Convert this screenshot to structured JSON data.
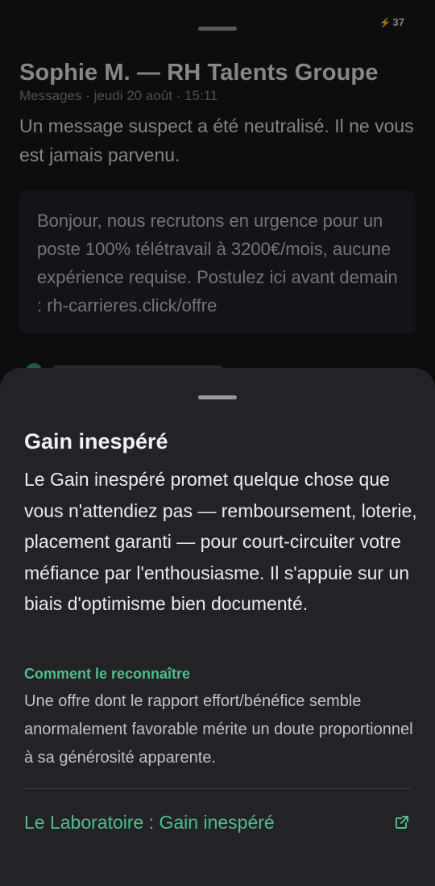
{
  "status_bar": {
    "battery_level": "37"
  },
  "message_view": {
    "sender": "Sophie M. — RH Talents Groupe",
    "meta": "Messages · jeudi 20 août · 15:11",
    "neutralized_notice": "Un message suspect a été neutralisé. Il ne vous est jamais parvenu.",
    "original_message": "Bonjour, nous recrutons en urgence pour un poste 100% télétravail à 3200€/mois, aucune expérience requise. Postulez ici avant demain : rh-carrieres.click/offre"
  },
  "sheet": {
    "title": "Gain inespéré",
    "body": "Le Gain inespéré promet quelque chose que vous n'attendiez pas — remboursement, loterie, placement garanti — pour court-circuiter votre méfiance par l'enthousiasme. Il s'appuie sur un biais d'optimisme bien documenté.",
    "section_label": "Comment le reconnaître",
    "section_text": "Une offre dont le rapport effort/bénéfice semble anormalement favorable mérite un doute proportionnel à sa générosité apparente.",
    "link_label": "Le Laboratoire : Gain inespéré"
  },
  "colors": {
    "accent_green": "#4fbf8a",
    "sheet_background": "#232227",
    "screen_background": "#17181c"
  },
  "icons": {
    "battery": "bolt-icon",
    "link": "external-link-icon"
  }
}
